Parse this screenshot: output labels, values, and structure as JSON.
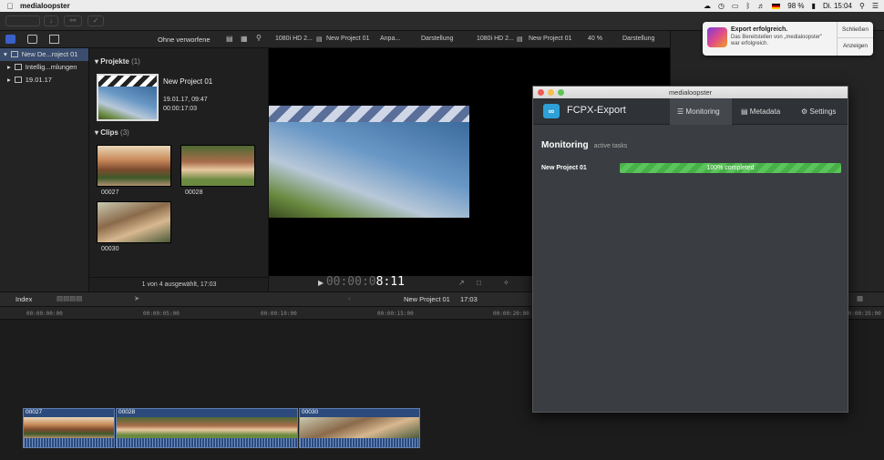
{
  "menubar": {
    "app_name": "medialoopster",
    "battery": "98 %",
    "clock": "Di. 15:04"
  },
  "browser_bar": {
    "filter": "Ohne verworfene"
  },
  "viewer_bar": {
    "format_left": "1080i HD 2...",
    "project_left": "New Project 01",
    "fit_left": "Anpa...",
    "display_left": "Darstellung",
    "format_right": "1080i HD 2...",
    "project_right": "New Project 01",
    "zoom": "40 %",
    "display_right": "Darstellung"
  },
  "sidebar": {
    "items": [
      {
        "label": "New De...roject 01"
      },
      {
        "label": "Intellig...mlungen"
      },
      {
        "label": "19.01.17"
      }
    ]
  },
  "browser": {
    "projects_heading": "Projekte",
    "projects_count": "(1)",
    "project_name": "New Project 01",
    "project_date": "19.01.17, 09:47",
    "project_duration": "00:00:17:03",
    "clips_heading": "Clips",
    "clips_count": "(3)",
    "clips": [
      "00027",
      "00028",
      "00030"
    ],
    "status": "1 von 4 ausgewählt, 17:03"
  },
  "viewer": {
    "timecode_dim": "00:00:0",
    "timecode_bright": "8:11"
  },
  "timeline": {
    "index_label": "Index",
    "project_name": "New Project 01",
    "duration": "17:03",
    "ruler": [
      "00:00:00:00",
      "00:00:05:00",
      "00:00:10:00",
      "00:00:15:00",
      "00:00:20:00",
      "00:00:35:00"
    ],
    "clips": [
      "00027",
      "00028",
      "00030"
    ]
  },
  "notification": {
    "title": "Export erfolgreich.",
    "body": "Das Bereitstellen von „medialoopster\" war erfolgreich.",
    "close_label": "Schließen",
    "show_label": "Anzeigen"
  },
  "export_window": {
    "window_title": "medialoopster",
    "app_name": "FCPX-Export",
    "tabs": [
      {
        "label": "Monitoring",
        "icon": "list-icon"
      },
      {
        "label": "Metadata",
        "icon": "document-icon"
      },
      {
        "label": "Settings",
        "icon": "gear-icon"
      }
    ],
    "monitoring_title": "Monitoring",
    "monitoring_subtitle": "active tasks",
    "task": {
      "name": "New Project 01",
      "progress": 1.0,
      "progress_label": "100% completed"
    }
  }
}
